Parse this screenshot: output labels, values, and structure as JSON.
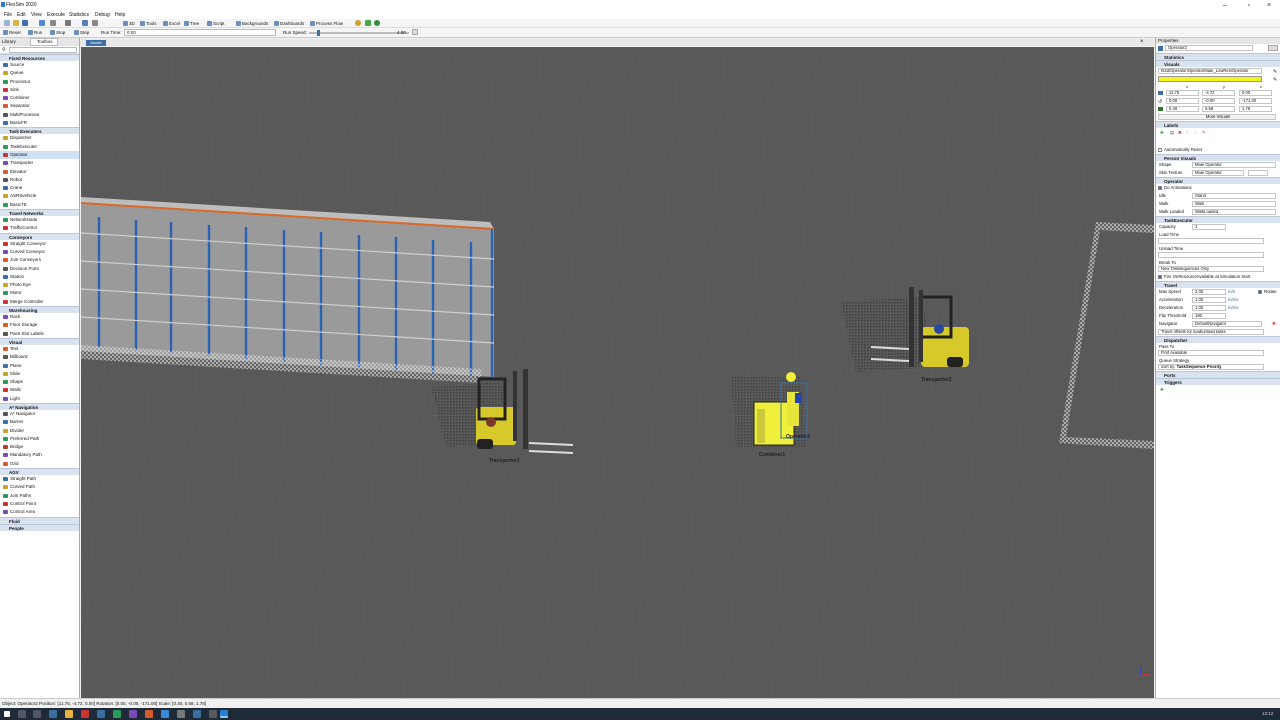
{
  "window": {
    "title": "FlexSim 2020"
  },
  "menu": [
    "File",
    "Edit",
    "View",
    "Execute",
    "Statistics",
    "Debug",
    "Help"
  ],
  "toolbar1": {
    "buttons": [
      "3D",
      "Tools",
      "Excel",
      "Tree",
      "Script",
      "Backgrounds",
      "Dashboards",
      "Process Flow"
    ]
  },
  "toolbar2": {
    "reset": "Reset",
    "run": "Run",
    "stop": "Stop",
    "step": "Step",
    "run_time_label": "Run Time:",
    "run_time_value": "0.00",
    "run_speed_label": "Run Speed:",
    "run_speed_value": "4.00"
  },
  "doc_tab": "Model",
  "library": {
    "tabs": [
      "Library",
      "Toolbox"
    ],
    "groups": [
      {
        "name": "Fixed Resources",
        "items": [
          "Source",
          "Queue",
          "Processor",
          "Sink",
          "Combiner",
          "Separator",
          "MultiProcessor",
          "BasicFR"
        ]
      },
      {
        "name": "Task Executers",
        "items": [
          "Dispatcher",
          "TaskExecuter",
          "Operator",
          "Transporter",
          "Elevator",
          "Robot",
          "Crane",
          "ASRSvehicle",
          "BasicTE"
        ]
      },
      {
        "name": "Travel Networks",
        "items": [
          "NetworkNode",
          "TrafficControl"
        ]
      },
      {
        "name": "Conveyors",
        "items": [
          "Straight Conveyor",
          "Curved Conveyor",
          "Join Conveyors",
          "Decision Point",
          "Station",
          "Photo Eye",
          "Motor",
          "Merge Controller"
        ]
      },
      {
        "name": "Warehousing",
        "items": [
          "Rack",
          "Floor Storage",
          "Paint Slot Labels"
        ]
      },
      {
        "name": "Visual",
        "items": [
          "Text",
          "Billboard",
          "Plane",
          "Slide",
          "Shape",
          "Walls",
          "Light"
        ]
      },
      {
        "name": "A* Navigation",
        "items": [
          "A* Navigator",
          "Barrier",
          "Divider",
          "Preferred Path",
          "Bridge",
          "Mandatory Path",
          "Grid"
        ]
      },
      {
        "name": "AGV",
        "items": [
          "Straight Path",
          "Curved Path",
          "Join Paths",
          "Control Point",
          "Control Area"
        ]
      },
      {
        "name": "Fluid",
        "items": []
      },
      {
        "name": "People",
        "items": []
      }
    ]
  },
  "scene": {
    "labels": {
      "transporter1": "Transporter1",
      "transporter2": "Transporter2",
      "combiner1": "Combiner1",
      "operator2": "Operator2"
    }
  },
  "properties": {
    "title": "Properties",
    "object_name": "Operator2",
    "sections": {
      "statistics": "Statistics",
      "visuals": "Visuals",
      "labels": "Labels",
      "person_visuals": "Person Visuals",
      "operator": "Operator",
      "taskexecuter": "TaskExecuter",
      "travel": "Travel",
      "dispatcher": "Dispatcher",
      "ports": "Ports",
      "triggers": "Triggers"
    },
    "shape_path": "fs3d\\Operator\\OperatorMale_LowRes\\Operator",
    "color": "#f3f31e",
    "xyz": [
      "x",
      "y",
      "z"
    ],
    "position": [
      "11.75",
      "-4.72",
      "0.00"
    ],
    "rotation": [
      "0.00",
      "-0.00",
      "-171.00"
    ],
    "scale": [
      "0.40",
      "0.58",
      "1.78"
    ],
    "more_visuals": "More Visuals",
    "auto_reset": "Automatically Reset",
    "shape_label": "Shape",
    "shape_value": "Male Operator",
    "skin_label": "Skin Texture",
    "skin_value": "Male Operator",
    "do_animations": "Do Animations",
    "idle_label": "Idle",
    "idle_value": "Stand",
    "walk_label": "Walk",
    "walk_value": "Walk",
    "walkloaded_label": "Walk Loaded",
    "walkloaded_value": "WalkLoaded",
    "capacity_label": "Capacity",
    "capacity_value": "1",
    "load_time_label": "Load Time",
    "unload_time_label": "Unload Time",
    "break_to_label": "Break To",
    "break_to_value": "New Tasksequences Only",
    "fire_on_resource": "Fire OnResourceAvailable at Simulation Start",
    "max_speed_label": "Max Speed",
    "max_speed_value": "2.00",
    "max_speed_unit": "m/s",
    "rotate_label": "Rotate",
    "accel_label": "Acceleration",
    "accel_value": "1.00",
    "accel_unit": "m/s/s",
    "decel_label": "Deceleration",
    "decel_value": "1.00",
    "decel_unit": "m/s/s",
    "flip_label": "Flip Threshold",
    "flip_value": "180",
    "navigator_label": "Navigator",
    "navigator_value": "DefaultNavigator",
    "travel_offsets": "Travel offsets for load/unload tasks",
    "pass_to_label": "Pass To",
    "pass_to_value": "First Available",
    "queue_strategy_label": "Queue Strategy",
    "queue_strategy_prefix": "Sort by:",
    "queue_strategy_value": "TaskSequence Priority"
  },
  "status": "Object: Operator2  Position: [11.75, -4.72, 0.00]  Rotation: [0.00, -0.00, -171.00]  Scale: [0.40, 0.58, 1.78]",
  "clock": "13:12"
}
